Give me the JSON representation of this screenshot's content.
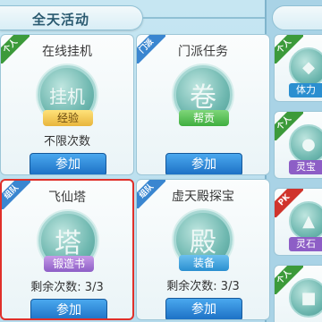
{
  "section_title": "全天活动",
  "cards": [
    {
      "ribbon": "个人",
      "title": "在线挂机",
      "icon": "挂机",
      "tag": "经验",
      "sub": "不限次数",
      "button": "参加"
    },
    {
      "ribbon": "门派",
      "title": "门派任务",
      "icon": "卷",
      "tag": "帮贡",
      "sub": "",
      "button": "参加"
    },
    {
      "ribbon": "组队",
      "title": "飞仙塔",
      "icon": "塔",
      "tag": "锻造书",
      "sub": "剩余次数: 3/3",
      "button": "参加"
    },
    {
      "ribbon": "组队",
      "title": "虚天殿探宝",
      "icon": "殿",
      "tag": "装备",
      "sub": "剩余次数: 3/3",
      "button": "参加"
    }
  ],
  "side_cards": [
    {
      "ribbon": "个人",
      "tag": "体力"
    },
    {
      "ribbon": "个人",
      "tag": "灵宝"
    },
    {
      "ribbon": "PK",
      "tag": "灵石"
    },
    {
      "ribbon": "个人",
      "tag": ""
    }
  ],
  "colors": {
    "selected_border": "#e0302a",
    "button": "#2a88d8"
  }
}
